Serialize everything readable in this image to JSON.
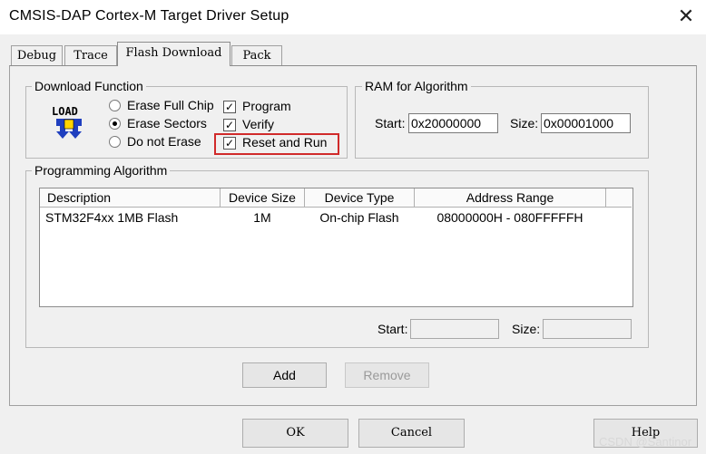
{
  "window": {
    "title": "CMSIS-DAP Cortex-M Target Driver Setup",
    "close_glyph": "✕"
  },
  "tabs": [
    {
      "label": "Debug"
    },
    {
      "label": "Trace"
    },
    {
      "label": "Flash Download",
      "active": true
    },
    {
      "label": "Pack"
    }
  ],
  "download_function": {
    "legend": "Download Function",
    "icon": "load-icon",
    "icon_text": "LOAD",
    "radios": [
      {
        "label": "Erase Full Chip",
        "selected": false
      },
      {
        "label": "Erase Sectors",
        "selected": true
      },
      {
        "label": "Do not Erase",
        "selected": false
      }
    ],
    "checks": [
      {
        "label": "Program",
        "checked": true
      },
      {
        "label": "Verify",
        "checked": true
      },
      {
        "label": "Reset and Run",
        "checked": true,
        "highlighted": true
      }
    ]
  },
  "ram": {
    "legend": "RAM for Algorithm",
    "start_label": "Start:",
    "start_value": "0x20000000",
    "size_label": "Size:",
    "size_value": "0x00001000"
  },
  "programming": {
    "legend": "Programming Algorithm",
    "columns": [
      "Description",
      "Device Size",
      "Device Type",
      "Address Range"
    ],
    "rows": [
      {
        "description": "STM32F4xx 1MB Flash",
        "size": "1M",
        "type": "On-chip Flash",
        "range": "08000000H - 080FFFFFH"
      }
    ],
    "start_label": "Start:",
    "start_value": "",
    "size_label": "Size:",
    "size_value": ""
  },
  "buttons": {
    "add": "Add",
    "remove": "Remove",
    "ok": "OK",
    "cancel": "Cancel",
    "help": "Help"
  },
  "watermark": "CSDN @Santinor",
  "colors": {
    "highlight": "#d02a2a",
    "background": "#f0f0f0"
  }
}
